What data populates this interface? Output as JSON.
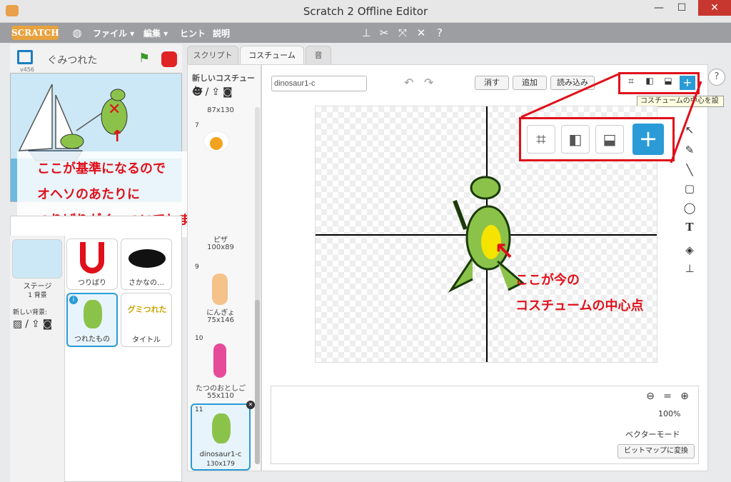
{
  "window": {
    "title": "Scratch 2 Offline Editor",
    "minimize": "—",
    "maximize": "☐",
    "close": "✕"
  },
  "menubar": {
    "logo": "SCRATCH",
    "file": "ファイル ▾",
    "edit": "編集 ▾",
    "tips": "ヒント",
    "about": "説明"
  },
  "stage_header": {
    "version": "v456",
    "project_name": "ぐみつれた"
  },
  "stage_annotation": [
    "ここが基準になるので",
    "オヘソのあたりに",
    "つりばりがくっついてしまう"
  ],
  "sprites": {
    "stage_label": "ステージ",
    "stage_count": "1 背景",
    "new_backdrop": "新しい背景:",
    "items": [
      {
        "label": "つりばり"
      },
      {
        "label": "さかなの…"
      },
      {
        "label": "つれたもの"
      },
      {
        "label": "タイトル"
      }
    ],
    "title_logo": "グミつれた"
  },
  "tabs": [
    "スクリプト",
    "コスチューム",
    "音"
  ],
  "costumes": {
    "new_label": "新しいコスチューム:",
    "items": [
      {
        "num": "",
        "name": "",
        "size": "87x130"
      },
      {
        "num": "7",
        "name": "",
        "size": ""
      },
      {
        "num": "",
        "name": "ピザ",
        "size": "100x89"
      },
      {
        "num": "9",
        "name": "にんぎょ",
        "size": "75x146"
      },
      {
        "num": "10",
        "name": "たつのおとしご",
        "size": "55x110"
      },
      {
        "num": "11",
        "name": "dinosaur1-c",
        "size": "130x179"
      }
    ]
  },
  "editor": {
    "costume_name": "dinosaur1-c",
    "clear": "消す",
    "add": "追加",
    "import": "読み込み",
    "tooltip": "コスチュームの中心を設",
    "zoom": "100%",
    "mode": "ベクターモード",
    "convert": "ビットマップに変換"
  },
  "editor_annotation": [
    "ここが今の",
    "コスチュームの中心点"
  ],
  "colors": {
    "accent": "#e0101a",
    "menubar": "#9c9ea2",
    "selected": "#2a9bd6"
  }
}
